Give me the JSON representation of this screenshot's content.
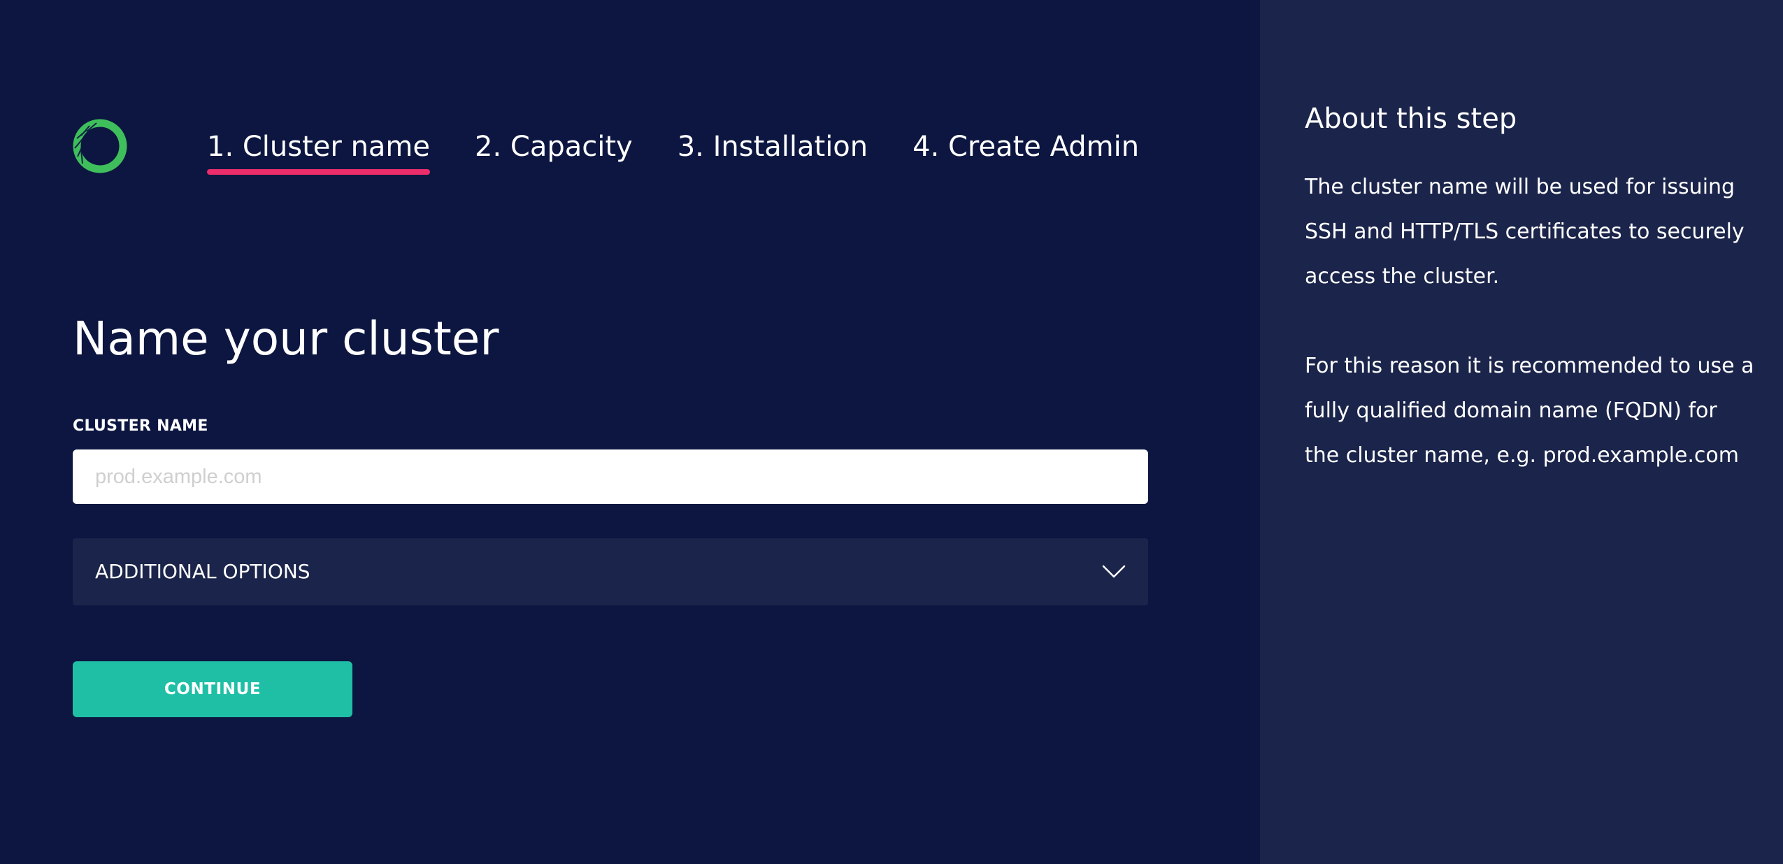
{
  "logo": {
    "icon": "cluster-ring-logo-icon",
    "color": "#3fbf5c"
  },
  "steps": [
    {
      "label": "1. Cluster name",
      "active": true
    },
    {
      "label": "2. Capacity",
      "active": false
    },
    {
      "label": "3. Installation",
      "active": false
    },
    {
      "label": "4. Create Admin",
      "active": false
    }
  ],
  "page": {
    "title": "Name your cluster"
  },
  "form": {
    "cluster_name_label": "CLUSTER NAME",
    "cluster_name_placeholder": "prod.example.com",
    "cluster_name_value": "",
    "additional_options_label": "ADDITIONAL OPTIONS",
    "additional_options_icon": "chevron-down-icon",
    "continue_label": "CONTINUE"
  },
  "sidebar": {
    "title": "About this step",
    "paragraphs": [
      "The cluster name will be used for issuing SSH and HTTP/TLS certificates to securely access the cluster.",
      "For this reason it is recommended to use a fully qualified domain name (FQDN) for the cluster name, e.g. prod.example.com"
    ]
  },
  "colors": {
    "background": "#0c1640",
    "panel": "#1b244a",
    "active_underline": "#ec2d6c",
    "primary_button": "#1fbfa6",
    "logo": "#3fbf5c"
  }
}
